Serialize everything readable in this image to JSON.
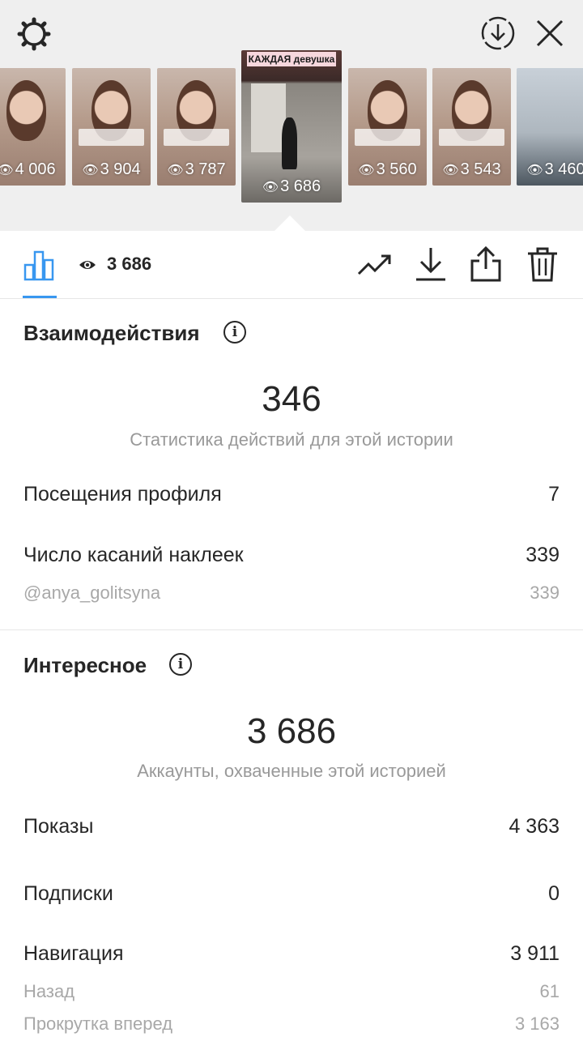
{
  "header": {
    "icons": [
      "gear-icon",
      "download-circle-icon",
      "close-icon"
    ]
  },
  "stories": [
    {
      "views": "4 006"
    },
    {
      "views": "3 904"
    },
    {
      "views": "3 787"
    },
    {
      "views": "3 686",
      "title": "КАЖДАЯ девушка",
      "active": true
    },
    {
      "views": "3 560"
    },
    {
      "views": "3 543"
    },
    {
      "views": "3 460"
    }
  ],
  "toolbar": {
    "views_total": "3 686",
    "icons": [
      "bar-chart-icon",
      "eye-icon",
      "trend-icon",
      "download-icon",
      "share-icon",
      "trash-icon"
    ]
  },
  "interactions": {
    "title": "Взаимодействия",
    "total": "346",
    "subtitle": "Статистика действий для этой истории",
    "rows": [
      {
        "label": "Посещения профиля",
        "value": "7"
      },
      {
        "label": "Число касаний наклеек",
        "value": "339"
      },
      {
        "label": "@anya_golitsyna",
        "value": "339"
      }
    ]
  },
  "discovery": {
    "title": "Интересное",
    "total": "3 686",
    "subtitle": "Аккаунты, охваченные этой историей",
    "rows": [
      {
        "label": "Показы",
        "value": "4 363"
      },
      {
        "label": "Подписки",
        "value": "0"
      },
      {
        "label": "Навигация",
        "value": "3 911"
      },
      {
        "label": "Назад",
        "value": "61"
      },
      {
        "label": "Прокрутка вперед",
        "value": "3 163"
      }
    ]
  },
  "colors": {
    "accent": "#3897f0",
    "text": "#262626",
    "muted": "#999999",
    "background_top": "#efefef"
  }
}
